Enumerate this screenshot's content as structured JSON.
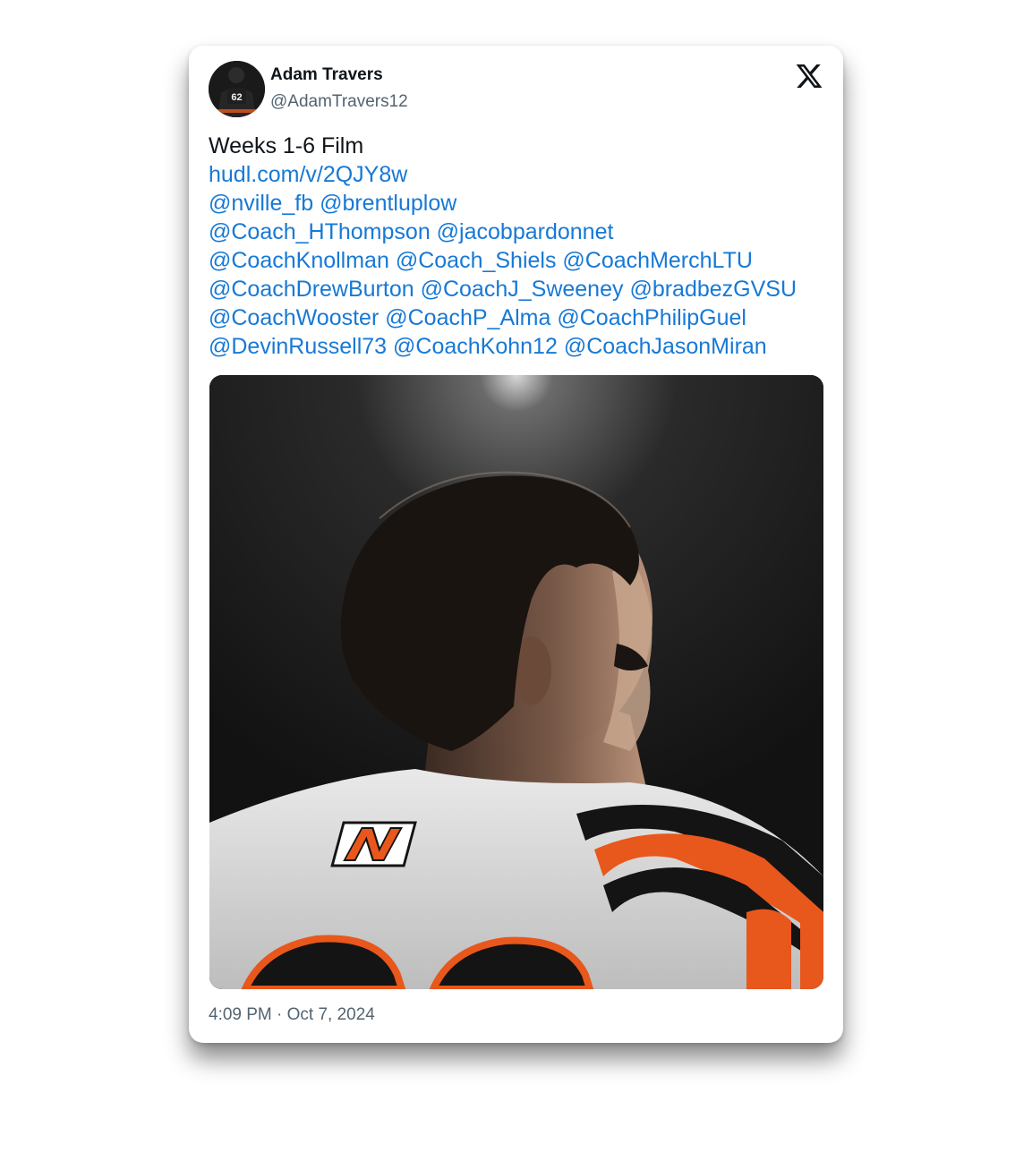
{
  "author": {
    "display_name": "Adam Travers",
    "handle": "@AdamTravers12",
    "avatar_jersey_number": "62"
  },
  "platform": {
    "logo_icon": "x-logo-icon"
  },
  "tweet": {
    "first_line": "Weeks 1-6 Film",
    "link": "hudl.com/v/2QJY8w",
    "mention_lines": [
      [
        "@nville_fb",
        "@brentluplow"
      ],
      [
        "@Coach_HThompson",
        "@jacobpardonnet"
      ],
      [
        "@CoachKnollman",
        "@Coach_Shiels",
        "@CoachMerchLTU"
      ],
      [
        "@CoachDrewBurton",
        "@CoachJ_Sweeney",
        "@bradbezGVSU"
      ],
      [
        "@CoachWooster",
        "@CoachP_Alma",
        "@CoachPhilipGuel"
      ],
      [
        "@DevinRussell73",
        "@CoachKohn12",
        "@CoachJasonMiran"
      ]
    ],
    "timestamp": "4:09 PM · Oct 7, 2024"
  },
  "colors": {
    "link": "#1779d6",
    "text": "#0f1419",
    "secondary": "#536471",
    "jersey_orange": "#e8571c"
  }
}
